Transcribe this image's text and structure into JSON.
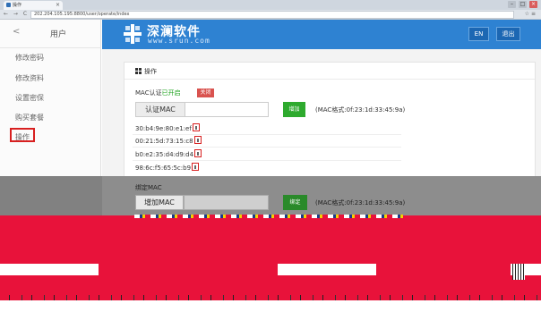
{
  "browser": {
    "tab_title": "操作",
    "url": "202.204.105.195:8800/user/operate/index",
    "close_symbol": "×",
    "nav_symbols": "← → C",
    "addr_icons": "☆ ≡",
    "window_controls": [
      "–",
      "□",
      "×"
    ]
  },
  "sidebar": {
    "back_symbol": "<",
    "title": "用户",
    "items": [
      {
        "label": "修改密码"
      },
      {
        "label": "修改资料"
      },
      {
        "label": "设置密保"
      },
      {
        "label": "购买套餐"
      },
      {
        "label": "操作",
        "active": true
      }
    ]
  },
  "header": {
    "brand_cn": "深澜软件",
    "brand_en": "www.srun.com",
    "lang_button": "EN",
    "exit_button": "退出"
  },
  "panel": {
    "title": "操作",
    "mac_auth_label": "MAC认证",
    "mac_auth_status": "已开启",
    "mac_auth_off_button": "关闭",
    "auth_input_label": "认证MAC",
    "add_button": "增加",
    "mac_format_hint": "(MAC格式:0f:23:1d:33:45:9a)",
    "mac_list": [
      "30:b4:9e:80:e1:ef",
      "00:21:5d:73:15:c8",
      "b0:e2:35:d4:d9:d4",
      "98:6c:f5:65:5c:b9"
    ],
    "bind_section_label": "绑定MAC",
    "bind_input_label": "增加MAC",
    "bind_button": "绑定",
    "bind_format_hint": "(MAC格式:0f:23:1d:33:45:9a)"
  },
  "colors": {
    "header_blue": "#2e82d2",
    "add_green": "#2eaa2e",
    "status_green": "#19a019",
    "danger_red": "#d9534f",
    "highlight_red": "#d82020"
  }
}
